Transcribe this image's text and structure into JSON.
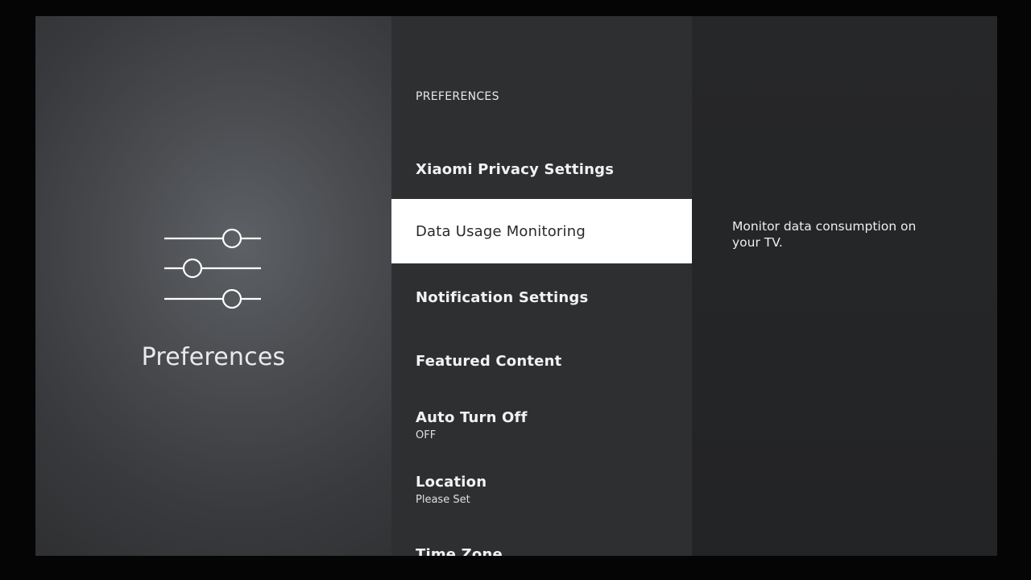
{
  "left_panel": {
    "title": "Preferences",
    "icon": "sliders-icon"
  },
  "menu": {
    "header": "PREFERENCES",
    "items": [
      {
        "label": "Xiaomi Privacy Settings",
        "sub": null
      },
      {
        "label": "Data Usage Monitoring",
        "sub": null,
        "selected": true
      },
      {
        "label": "Notification Settings",
        "sub": null
      },
      {
        "label": "Featured Content",
        "sub": null
      },
      {
        "label": "Auto Turn Off",
        "sub": "OFF"
      },
      {
        "label": "Location",
        "sub": "Please Set"
      },
      {
        "label": "Time Zone",
        "sub": null
      }
    ]
  },
  "detail": {
    "description": "Monitor data consumption on your TV."
  },
  "colors": {
    "selected_bg": "#ffffff",
    "selected_text": "#2a2a2a",
    "text": "#f2f2f2"
  }
}
